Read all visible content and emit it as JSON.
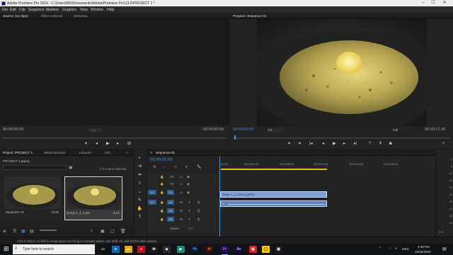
{
  "window": {
    "title": "Adobe Premiere Pro 2019 - C:\\Users\\MSI\\Documents\\Adobe\\Premiere Pro\\13.0\\PROJECT 1 *",
    "minimize": "─",
    "maximize": "☐",
    "close": "✕"
  },
  "menu": [
    "File",
    "Edit",
    "Clip",
    "Sequence",
    "Markers",
    "Graphics",
    "View",
    "Window",
    "Help"
  ],
  "source_panel": {
    "tabs": [
      "Source: (no clips)",
      "Effect Controls",
      "Metadata"
    ],
    "timecode_left": "00;00;00;00",
    "timecode_right": "00;00;00;00",
    "page_label": "Page 1"
  },
  "program_panel": {
    "tab": "Program: Sequence 01",
    "timecode": "00;00;00;00",
    "fit": "Fit",
    "quality": "Full",
    "duration": "00;00;12;26"
  },
  "project_panel": {
    "tabs": [
      "Project: PROJECT 1",
      "Media Browser",
      "Libraries",
      "Info"
    ],
    "project_file": "PROJECT 1.prproj",
    "selection_info": "1 of 2 items selected",
    "items": [
      {
        "name": "Sequence 01",
        "duration": "12;26"
      },
      {
        "name": "Gorgo 1_1_1.avi",
        "duration": "6;13"
      }
    ]
  },
  "timeline": {
    "tab": "Sequence 01",
    "timecode": "00;00;00;00",
    "ruler": [
      "00;00",
      "00;00;04;00",
      "00;00;08;00",
      "00;00;12;00",
      "00;00;16;00",
      "00;00;20;00"
    ],
    "video_tracks": [
      "V3",
      "V2",
      "V1"
    ],
    "audio_tracks": [
      "A1",
      "A2",
      "A3"
    ],
    "target_labels": [
      "V1",
      "A1"
    ],
    "master_label": "Master",
    "master_value": "0.0",
    "clip_label": "Gorgo 1_1_1.avi [V] [39%]",
    "audio_clip_label": "fx"
  },
  "meters": {
    "labels": [
      "0",
      "-6",
      "-12",
      "-18",
      "-24",
      "-30",
      "-36",
      "-42",
      "-48",
      "-54"
    ],
    "footer": "S S"
  },
  "status": "Click to select, or click in empty space and drag to marquee select. Use Shift, Alt, and Ctrl for other options.",
  "taskbar": {
    "search_placeholder": "Type here to search",
    "time": "4:48 PM",
    "date": "10/25/2020",
    "lang": "ENG"
  }
}
